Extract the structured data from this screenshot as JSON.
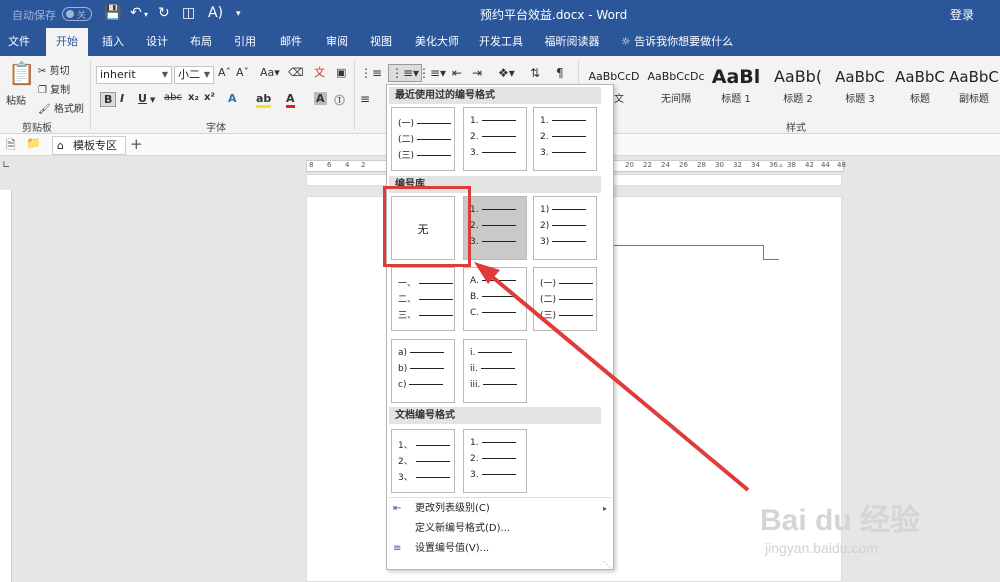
{
  "titlebar": {
    "autosave_label": "自动保存",
    "autosave_state": "关",
    "doc_title": "预约平台效益.docx - Word",
    "login_label": "登录"
  },
  "tabs": [
    "文件",
    "开始",
    "插入",
    "设计",
    "布局",
    "引用",
    "邮件",
    "审阅",
    "视图",
    "美化大师",
    "开发工具",
    "福昕阅读器"
  ],
  "tab_search": "告诉我你想要做什么",
  "clipboard": {
    "paste": "粘贴",
    "cut": "剪切",
    "copy": "复制",
    "format_painter": "格式刷",
    "group_label": "剪贴板"
  },
  "font": {
    "font_name": "inherit",
    "font_size": "小二",
    "group_label": "字体"
  },
  "styles": {
    "group_label": "样式",
    "items": [
      {
        "sample": "AaBbCcD",
        "name": "正文"
      },
      {
        "sample": "AaBbCcDc",
        "name": "无间隔"
      },
      {
        "sample": "AaBl",
        "name": "标题 1"
      },
      {
        "sample": "AaBb(",
        "name": "标题 2"
      },
      {
        "sample": "AaBbC",
        "name": "标题 3"
      },
      {
        "sample": "AaBbC",
        "name": "标题"
      },
      {
        "sample": "AaBbC",
        "name": "副标题"
      }
    ]
  },
  "tabstrip": {
    "template_tab": "模板专区"
  },
  "ruler_numbers": [
    "8",
    "6",
    "4",
    "2",
    "",
    "2",
    "",
    "20",
    "22",
    "24",
    "26",
    "28",
    "30",
    "32",
    "34",
    "36",
    "38",
    "",
    "42",
    "44",
    "46",
    "48"
  ],
  "dropdown": {
    "recent_header": "最近使用过的编号格式",
    "library_header": "编号库",
    "doc_header": "文档编号格式",
    "none_label": "无",
    "recent": [
      [
        "(一)",
        "(二)",
        "(三)"
      ],
      [
        "1.",
        "2.",
        "3."
      ],
      [
        "1.",
        "2.",
        "3."
      ]
    ],
    "library": [
      [
        "1.",
        "2.",
        "3."
      ],
      [
        "1)",
        "2)",
        "3)"
      ],
      [
        "一、",
        "二、",
        "三、"
      ],
      [
        "A.",
        "B.",
        "C."
      ],
      [
        "(一)",
        "(二)",
        "(三)"
      ],
      [
        "a)",
        "b)",
        "c)"
      ],
      [
        "i.",
        "ii.",
        "iii."
      ]
    ],
    "doc": [
      [
        "1、",
        "2、",
        "3、"
      ],
      [
        "1.",
        "2.",
        "3."
      ]
    ],
    "menu": [
      {
        "label": "更改列表级别(C)",
        "icon": "change-level-icon",
        "arrow": "▸"
      },
      {
        "label": "定义新编号格式(D)...",
        "icon": "",
        "arrow": ""
      },
      {
        "label": "设置编号值(V)...",
        "icon": "set-value-icon",
        "arrow": ""
      }
    ]
  },
  "watermark": {
    "brand": "Bai du 经验",
    "url": "jingyan.baidu.com"
  },
  "colors": {
    "ribbon_blue": "#2b579a",
    "highlight_red": "#e03a3a"
  }
}
